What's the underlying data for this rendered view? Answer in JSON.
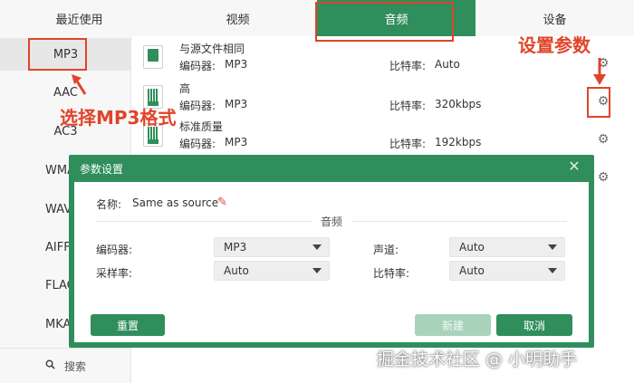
{
  "tabs": [
    {
      "label": "最近使用",
      "active": false
    },
    {
      "label": "视频",
      "active": false
    },
    {
      "label": "音频",
      "active": true
    },
    {
      "label": "设备",
      "active": false
    }
  ],
  "formats": [
    "MP3",
    "AAC",
    "AC3",
    "WMA",
    "WAV",
    "AIFF",
    "FLAC",
    "MKA"
  ],
  "selected_format": "MP3",
  "search_label": "搜索",
  "presets": [
    {
      "name": "与源文件相同",
      "encoder_label": "编码器:",
      "encoder": "MP3",
      "bitrate_label": "比特率:",
      "bitrate": "Auto"
    },
    {
      "name": "高",
      "encoder_label": "编码器:",
      "encoder": "MP3",
      "bitrate_label": "比特率:",
      "bitrate": "320kbps"
    },
    {
      "name": "标准质量",
      "encoder_label": "编码器:",
      "encoder": "MP3",
      "bitrate_label": "比特率:",
      "bitrate": "192kbps"
    }
  ],
  "annotations": {
    "select_mp3": "选择MP3格式",
    "set_params": "设置参数"
  },
  "dialog": {
    "title": "参数设置",
    "name_label": "名称:",
    "name_value": "Same as source",
    "section": "音频",
    "encoder_label": "编码器:",
    "encoder_value": "MP3",
    "channel_label": "声道:",
    "channel_value": "Auto",
    "samplerate_label": "采样率:",
    "samplerate_value": "Auto",
    "bitrate_label": "比特率:",
    "bitrate_value": "Auto",
    "reset_label": "重置",
    "new_label": "新建",
    "cancel_label": "取消"
  },
  "watermark": "掘金技术社区 @ 小明助手",
  "colors": {
    "accent": "#2f8e5c",
    "annotation": "#e0442a"
  }
}
